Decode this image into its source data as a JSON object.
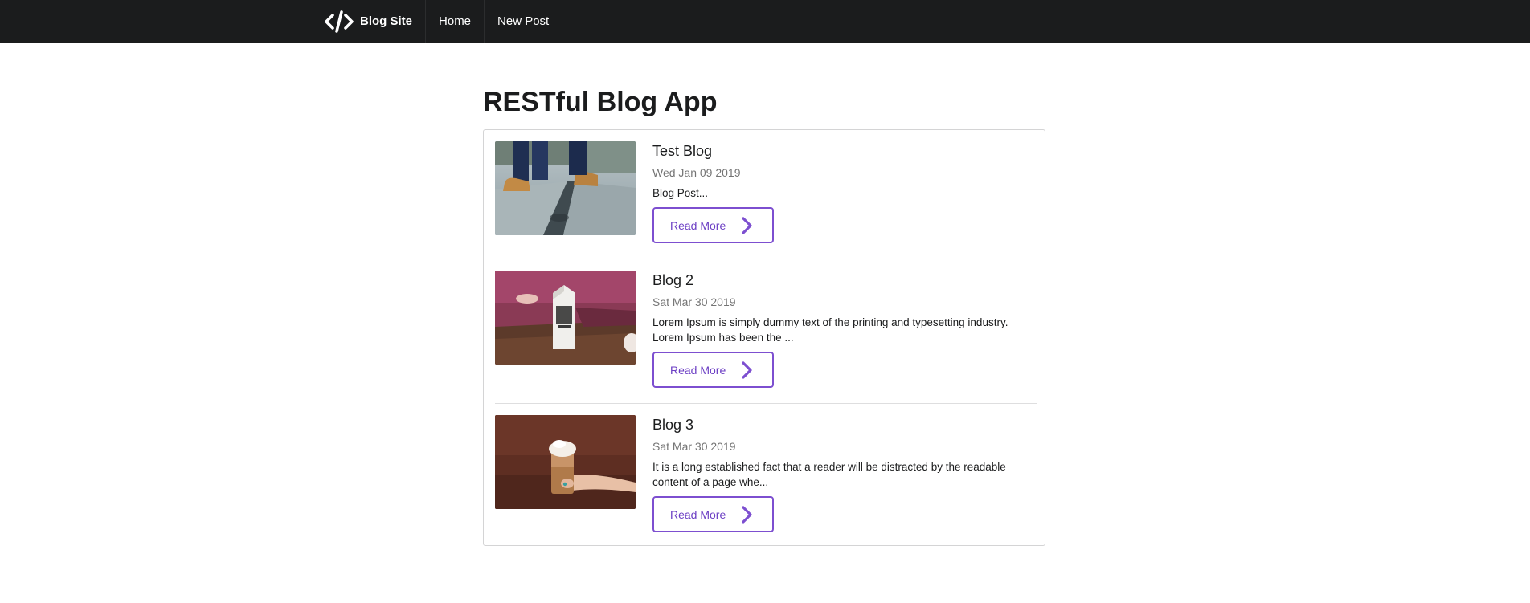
{
  "navbar": {
    "brand_icon": "code-icon",
    "brand_label": "Blog Site",
    "items": [
      {
        "label": "Home"
      },
      {
        "label": "New Post"
      }
    ]
  },
  "page": {
    "title": "RESTful Blog App"
  },
  "posts": [
    {
      "title": "Test Blog",
      "date": "Wed Jan 09 2019",
      "description": "Blog Post...",
      "button_label": "Read More",
      "button_icon": "chevron-right-icon",
      "image": "walking-boots-photo"
    },
    {
      "title": "Blog 2",
      "date": "Sat Mar 30 2019",
      "description": "Lorem Ipsum is simply dummy text of the printing and typesetting industry. Lorem Ipsum has been the ...",
      "button_label": "Read More",
      "button_icon": "chevron-right-icon",
      "image": "milk-carton-photo"
    },
    {
      "title": "Blog 3",
      "date": "Sat Mar 30 2019",
      "description": "It is a long established fact that a reader will be distracted by the readable content of a page whe...",
      "button_label": "Read More",
      "button_icon": "chevron-right-icon",
      "image": "iced-coffee-photo"
    }
  ],
  "colors": {
    "navbar_bg": "#1b1c1d",
    "accent": "#7d4fd0",
    "text": "#1b1c1d"
  }
}
